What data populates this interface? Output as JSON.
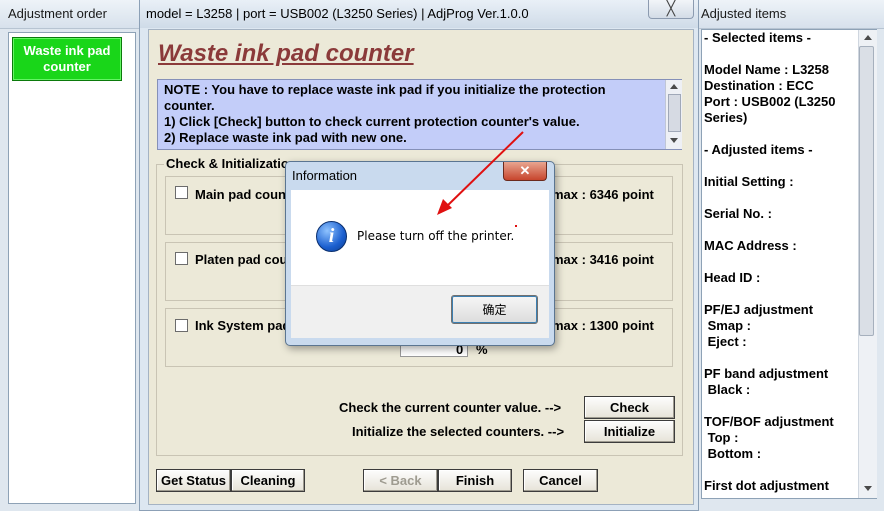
{
  "left_panel": {
    "title": "Adjustment order",
    "items": [
      {
        "label": "Waste ink pad counter"
      }
    ]
  },
  "main_window": {
    "title": "model = L3258 | port = USB002 (L3250 Series) | AdjProg Ver.1.0.0",
    "close_glyph": "╳",
    "heading": "Waste ink pad counter",
    "note_lines": [
      "NOTE : You have to replace waste ink pad if you initialize the protection",
      "counter.",
      "1) Click [Check] button to check current protection counter's value.",
      "2) Replace waste ink pad with new one."
    ],
    "group_label": "Check & Initialization",
    "counters": [
      {
        "label": "Main pad counter",
        "max_text": "max : 6346 point"
      },
      {
        "label": "Platen pad counter",
        "max_text": "max : 3416 point"
      },
      {
        "label": "Ink System pad counter",
        "max_text": "max : 1300 point",
        "value": "0",
        "unit": "%"
      }
    ],
    "check_prompt": "Check the current counter value. -->",
    "check_button": "Check",
    "init_prompt": "Initialize the selected counters. -->",
    "init_button": "Initialize",
    "bottom_buttons": {
      "get_status": "Get Status",
      "cleaning": "Cleaning",
      "back": "< Back",
      "finish": "Finish",
      "cancel": "Cancel"
    }
  },
  "right_panel": {
    "title": "Adjusted items",
    "lines": [
      "- Selected items -",
      "",
      "Model Name : L3258",
      "Destination : ECC",
      "Port : USB002 (L3250",
      "Series)",
      "",
      "- Adjusted items -",
      "",
      "Initial Setting :",
      "",
      "Serial No. :",
      "",
      "MAC Address :",
      "",
      "Head ID :",
      "",
      "PF/EJ adjustment",
      " Smap :",
      " Eject :",
      "",
      "PF band adjustment",
      " Black :",
      "",
      "TOF/BOF adjustment",
      " Top :",
      " Bottom :",
      "",
      "First dot adjustment"
    ]
  },
  "dialog": {
    "title": "Information",
    "close_glyph": "✕",
    "icon": "info-icon",
    "message": "Please turn off the printer.",
    "ok_button": "确定"
  },
  "colors": {
    "heading": "#8b3a3a",
    "note_background": "#c3cdf9",
    "waste_button": "#19d619",
    "annotation_arrow": "#e01010"
  }
}
